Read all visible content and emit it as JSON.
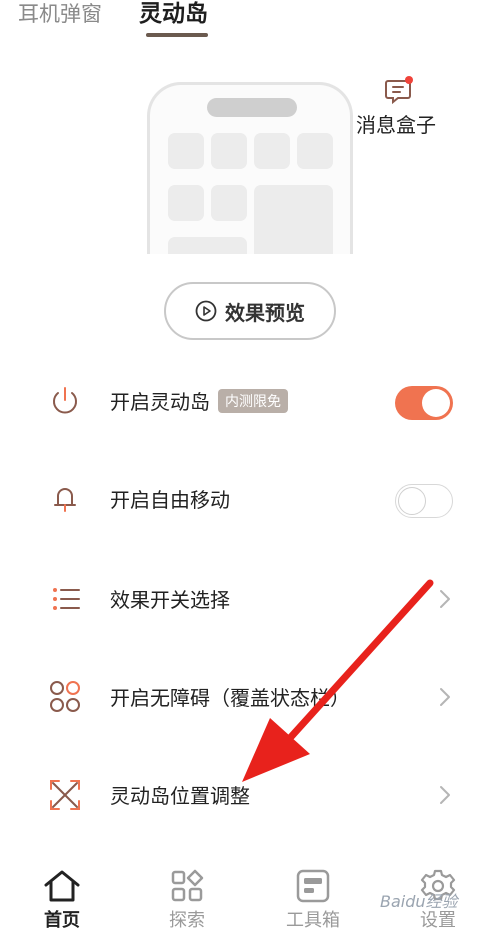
{
  "tabs": [
    {
      "label": "耳机弹窗"
    },
    {
      "label": "灵动岛"
    }
  ],
  "message_box": {
    "label": "消息盒子",
    "icon": "message-box-icon",
    "dot_color": "#f0433a"
  },
  "preview_button": {
    "label": "效果预览",
    "icon": "play-circle-icon"
  },
  "settings": [
    {
      "label": "开启灵动岛",
      "badge": "内测限免",
      "icon": "power-icon",
      "control": "toggle",
      "state": "on"
    },
    {
      "label": "开启自由移动",
      "icon": "bell-icon",
      "control": "toggle",
      "state": "off"
    },
    {
      "label": "效果开关选择",
      "icon": "list-icon",
      "control": "chevron"
    },
    {
      "label": "开启无障碍（覆盖状态栏）",
      "icon": "grid-circles-icon",
      "control": "chevron"
    },
    {
      "label": "灵动岛位置调整",
      "icon": "expand-icon",
      "control": "chevron"
    }
  ],
  "bottom_nav": [
    {
      "label": "首页",
      "icon": "home-icon",
      "active": true
    },
    {
      "label": "探索",
      "icon": "explore-icon",
      "active": false
    },
    {
      "label": "工具箱",
      "icon": "toolbox-icon",
      "active": false
    },
    {
      "label": "设置",
      "icon": "gear-icon",
      "active": false
    }
  ],
  "watermark": "Baidu经验",
  "colors": {
    "accent": "#f07350",
    "icon_brown": "#8a5a4c",
    "badge_bg": "#b9afa8"
  }
}
